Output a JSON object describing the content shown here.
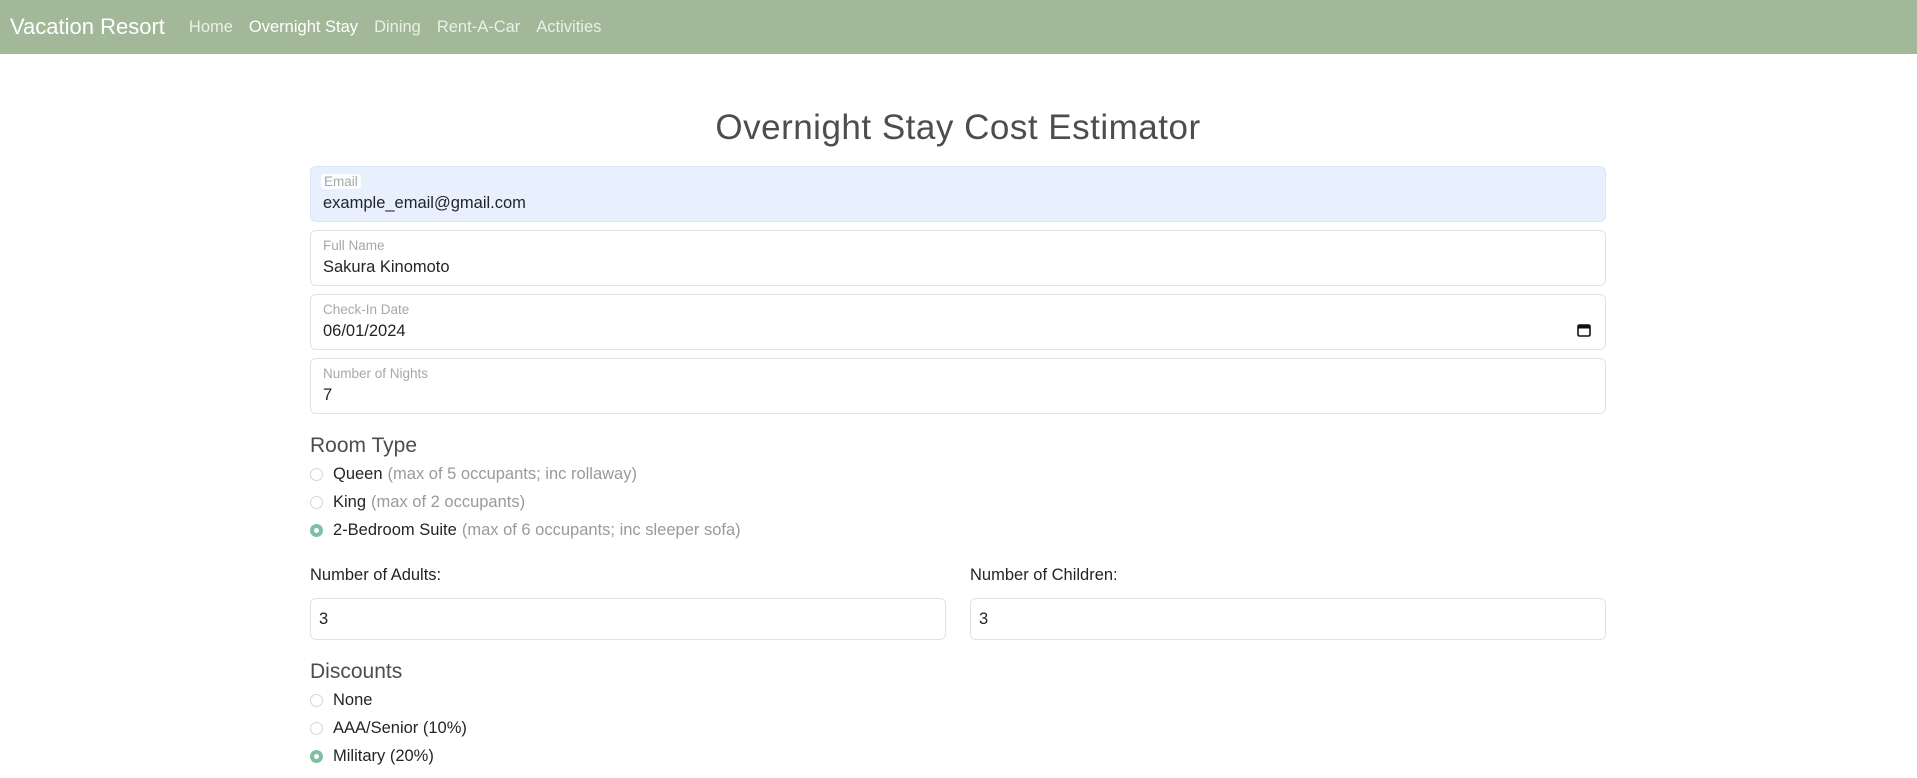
{
  "navbar": {
    "brand": "Vacation Resort",
    "links": [
      "Home",
      "Overnight Stay",
      "Dining",
      "Rent-A-Car",
      "Activities"
    ],
    "active": "Overnight Stay"
  },
  "page": {
    "title": "Overnight Stay Cost Estimator"
  },
  "form": {
    "email": {
      "label": "Email",
      "value": "example_email@gmail.com"
    },
    "full_name": {
      "label": "Full Name",
      "value": "Sakura Kinomoto"
    },
    "check_in": {
      "label": "Check-In Date",
      "value": "06/01/2024"
    },
    "nights": {
      "label": "Number of Nights",
      "value": "7"
    },
    "room_type": {
      "title": "Room Type",
      "options": [
        {
          "label": "Queen",
          "note": "(max of 5 occupants; inc rollaway)",
          "checked": false
        },
        {
          "label": "King",
          "note": "(max of 2 occupants)",
          "checked": false
        },
        {
          "label": "2-Bedroom Suite",
          "note": "(max of 6 occupants; inc sleeper sofa)",
          "checked": true
        }
      ]
    },
    "adults": {
      "label": "Number of Adults:",
      "value": "3"
    },
    "children": {
      "label": "Number of Children:",
      "value": "3"
    },
    "discounts": {
      "title": "Discounts",
      "options": [
        {
          "label": "None",
          "checked": false
        },
        {
          "label": "AAA/Senior (10%)",
          "checked": false
        },
        {
          "label": "Military (20%)",
          "checked": true
        }
      ]
    }
  },
  "colors": {
    "navbar": "#a3b899",
    "radio_checked": "#7fbfa4",
    "autofill": "#e8f0fe"
  },
  "icons": {
    "date_picker": "calendar-icon"
  }
}
